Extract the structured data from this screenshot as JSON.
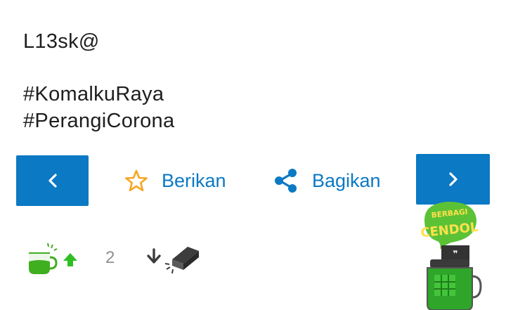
{
  "post": {
    "lines": [
      "L13sk@",
      "#KomalkuRaya",
      "#PerangiCorona"
    ]
  },
  "nav": {
    "prev_icon": "chevron-left-icon",
    "next_icon": "chevron-right-icon"
  },
  "actions": {
    "give_label": "Berikan",
    "give_icon": "star-outline-icon",
    "share_label": "Bagikan",
    "share_icon": "share-icon"
  },
  "votes": {
    "count": "2",
    "upvote_icon": "cendol-glass-up-icon",
    "downvote_icon": "bata-down-icon"
  },
  "colors": {
    "primary": "#0b79c4",
    "star": "#f5a623",
    "cendol_green": "#3fae1f",
    "upvote_arrow": "#2fbf24",
    "text": "#1e1e1e",
    "count": "#8f8f8f"
  }
}
